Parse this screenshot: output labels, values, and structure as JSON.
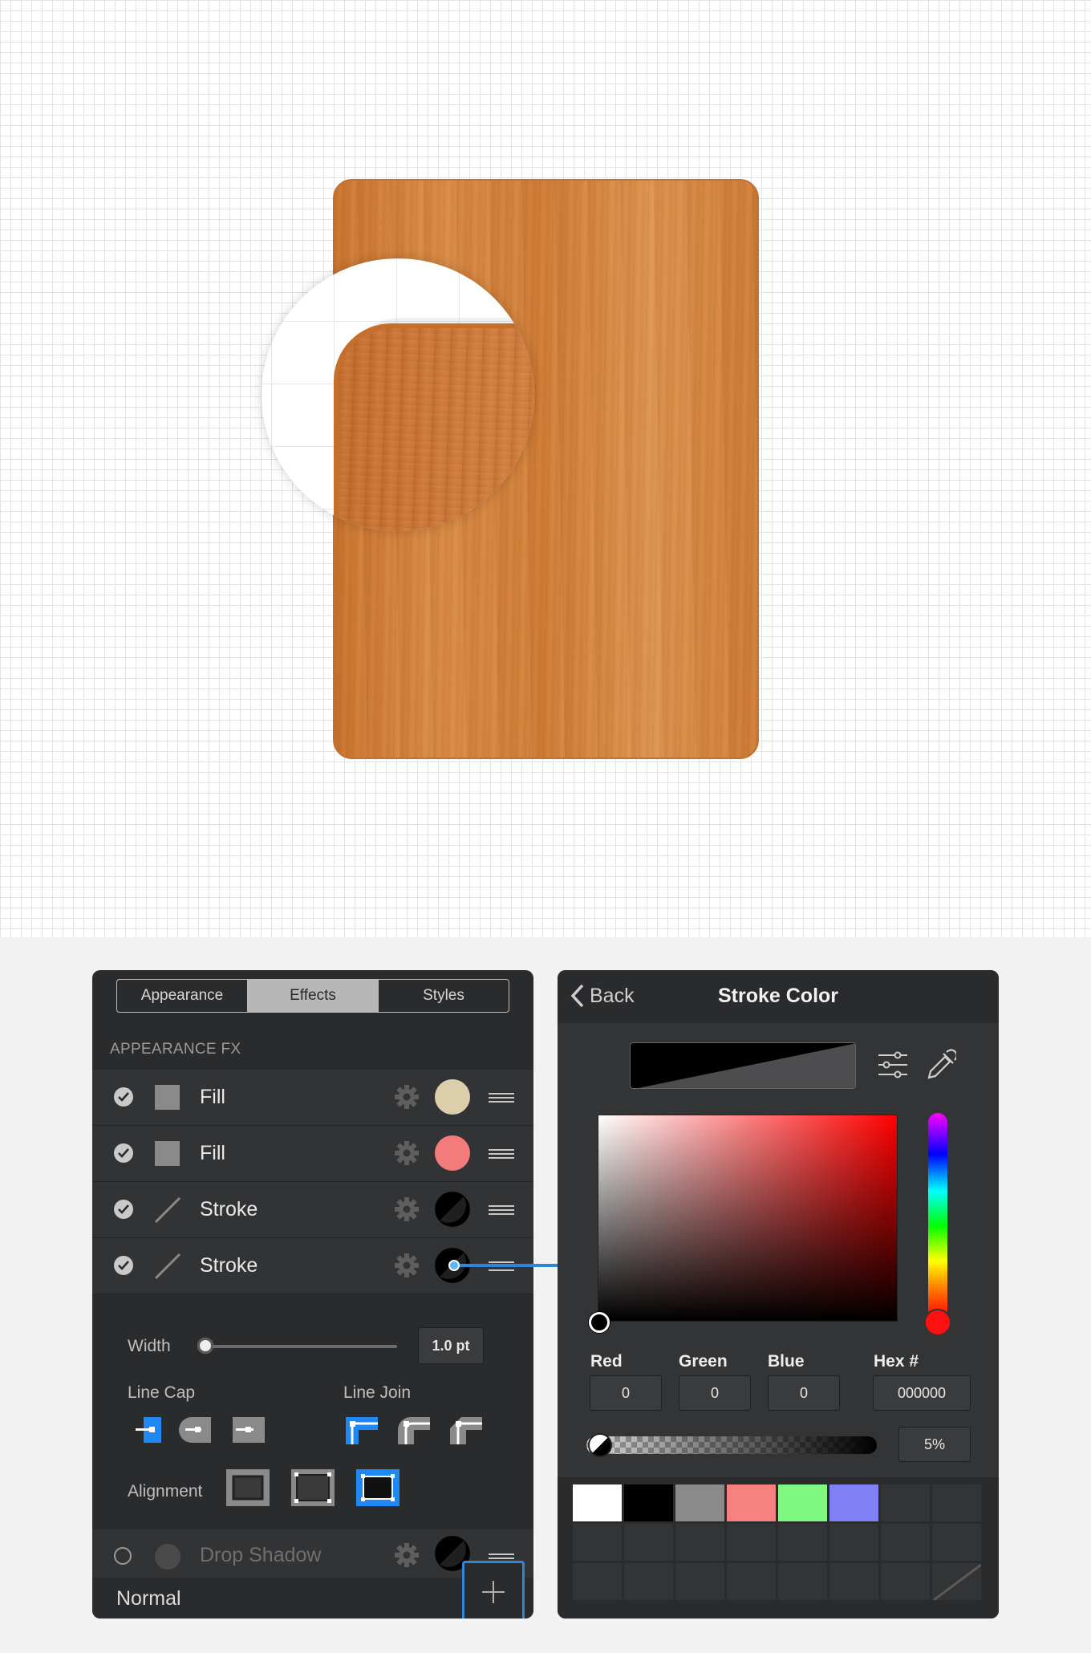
{
  "left_panel": {
    "tabs": [
      {
        "label": "Appearance",
        "active": false
      },
      {
        "label": "Effects",
        "active": true
      },
      {
        "label": "Styles",
        "active": false
      }
    ],
    "section_title": "APPEARANCE FX",
    "fx_rows": [
      {
        "label": "Fill",
        "checked": true,
        "kind": "fill",
        "swatch": "#dcceaa"
      },
      {
        "label": "Fill",
        "checked": true,
        "kind": "fill",
        "swatch": "#f37b7b"
      },
      {
        "label": "Stroke",
        "checked": true,
        "kind": "stroke",
        "swatch": "#000000"
      },
      {
        "label": "Stroke",
        "checked": true,
        "kind": "stroke",
        "swatch": "#000000"
      }
    ],
    "width_label": "Width",
    "width_value": "1.0 pt",
    "line_cap_label": "Line Cap",
    "line_join_label": "Line Join",
    "alignment_label": "Alignment",
    "drop_shadow_label": "Drop Shadow",
    "blend_mode": "Normal"
  },
  "right_panel": {
    "back_label": "Back",
    "title": "Stroke Color",
    "channels": {
      "red_label": "Red",
      "red": "0",
      "green_label": "Green",
      "green": "0",
      "blue_label": "Blue",
      "blue": "0",
      "hex_label": "Hex #",
      "hex": "000000"
    },
    "opacity": "5%",
    "palette": [
      "#ffffff",
      "#000000",
      "#8a8a8a",
      "#f78080",
      "#80f780",
      "#8080f7"
    ]
  },
  "colors": {
    "accent": "#1f88f5",
    "wood": "#d48440",
    "panel": "#2a2b2d"
  }
}
